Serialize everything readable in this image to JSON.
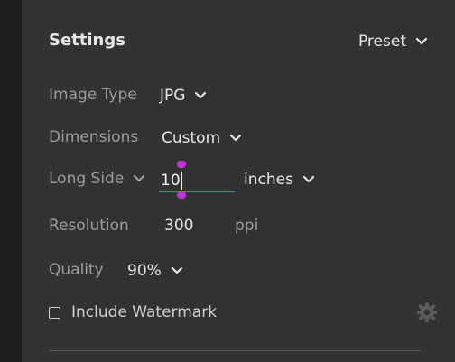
{
  "header": {
    "title": "Settings",
    "preset_label": "Preset"
  },
  "image_type": {
    "label": "Image Type",
    "value": "JPG"
  },
  "dimensions": {
    "label": "Dimensions",
    "value": "Custom"
  },
  "long_side": {
    "label": "Long Side",
    "input_value": "10",
    "unit": "inches"
  },
  "resolution": {
    "label": "Resolution",
    "value": "300",
    "unit": "ppi"
  },
  "quality": {
    "label": "Quality",
    "value": "90%"
  },
  "watermark": {
    "label": "Include Watermark",
    "checked": false
  },
  "icons": {
    "chevron": "chevron-down-icon",
    "gear": "gear-icon",
    "checkbox": "checkbox-icon"
  },
  "colors": {
    "panel_bg": "#323232",
    "input_underline": "#3b7cd6",
    "selection_handle": "#c133d6"
  }
}
